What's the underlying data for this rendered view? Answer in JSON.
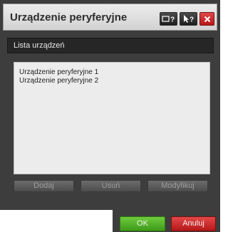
{
  "window": {
    "title": "Urządzenie peryferyjne",
    "title_buttons": [
      {
        "icon": "window-help-icon",
        "label": "□?"
      },
      {
        "icon": "pointer-help-icon",
        "label": "?"
      },
      {
        "icon": "close-icon",
        "label": "✕"
      }
    ]
  },
  "device_list": {
    "header": "Lista urządzeń",
    "items": [
      "Urządzenie peryferyjne 1",
      "Urządzenie peryferyjne 2"
    ]
  },
  "actions": {
    "add_label": "Dodaj",
    "remove_label": "Usuń",
    "modify_label": "Modyfikuj"
  },
  "footer": {
    "ok_label": "OK",
    "cancel_label": "Anuluj"
  },
  "colors": {
    "ok": "#4caf24",
    "cancel": "#c62222",
    "panel": "#3d3d3d"
  }
}
